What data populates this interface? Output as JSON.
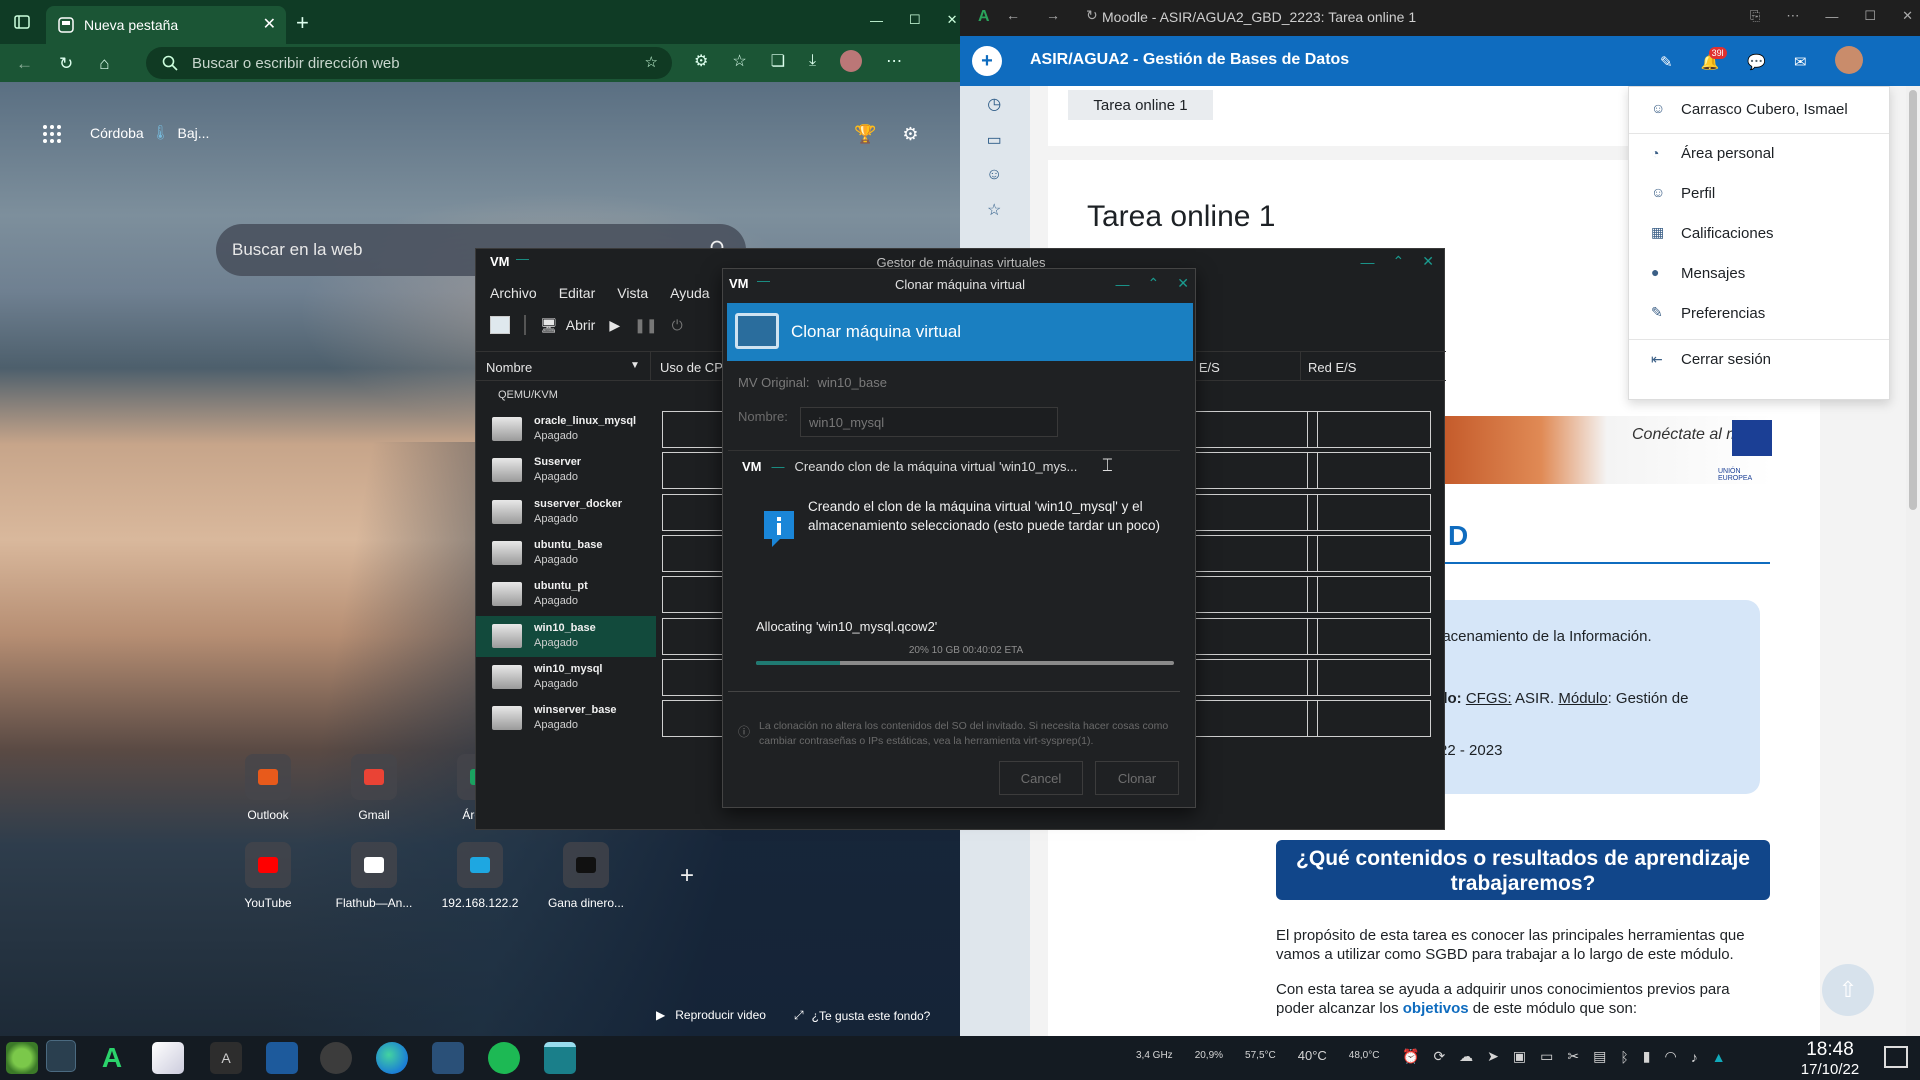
{
  "edge": {
    "tab_title": "Nueva pestaña",
    "address_placeholder": "Buscar o escribir dirección web",
    "weather_city": "Córdoba",
    "weather_text": "Baj...",
    "search_placeholder": "Buscar en la web",
    "tiles_row1": [
      {
        "label": "Outlook",
        "color": "#e85a1b"
      },
      {
        "label": "Gmail",
        "color": "#ea4335"
      },
      {
        "label": "Área p",
        "color": "#1aa260"
      }
    ],
    "tiles_row2": [
      {
        "label": "YouTube",
        "color": "#ff0000"
      },
      {
        "label": "Flathub—An...",
        "color": "#ffffff"
      },
      {
        "label": "192.168.122.2",
        "color": "#1ea7e1"
      },
      {
        "label": "Gana dinero...",
        "color": "#111111"
      }
    ],
    "play_video": "Reproducir video",
    "like_bg": "¿Te gusta este fondo?"
  },
  "moodle": {
    "window_title": "Moodle - ASIR/AGUA2_GBD_2223: Tarea online 1",
    "course_title": "ASIR/AGUA2 - Gestión de Bases de Datos",
    "notifications_count": "39l",
    "breadcrumb": "Tarea online 1",
    "heading": "Tarea online 1",
    "user_menu": [
      {
        "label": "Carrasco Cubero, Ismael",
        "icon": "user-icon"
      },
      {
        "label": "Área personal",
        "icon": "dashboard-icon"
      },
      {
        "label": "Perfil",
        "icon": "profile-icon"
      },
      {
        "label": "Calificaciones",
        "icon": "grades-icon"
      },
      {
        "label": "Mensajes",
        "icon": "message-icon"
      },
      {
        "label": "Preferencias",
        "icon": "wrench-icon"
      },
      {
        "label": "Cerrar sesión",
        "icon": "logout-icon"
      }
    ],
    "banner_text": "Conéctate al m",
    "banner_eu": "UNIÓN EUROPEA",
    "section_letter": "D",
    "info_line1": ": Almacenamiento de la Información.",
    "info_line2_bold": "y módulo:",
    "info_line2_u1": "CFGS:",
    "info_line2_mid": " ASIR. ",
    "info_line2_u2": "Módulo",
    "info_line2_end": ": Gestión de",
    "info_line3_bold": "o:",
    "info_line3_end": " 2022 - 2023",
    "blue_heading": "¿Qué contenidos o resultados de aprendizaje trabajaremos?",
    "para1": "El propósito de esta tarea es conocer las principales herramientas que vamos a utilizar como SGBD para trabajar a lo largo de este módulo.",
    "para2_start": "Con esta tarea se ayuda a adquirir unos conocimientos previos para poder alcanzar los ",
    "para2_link": "objetivos",
    "para2_end": " de este módulo que son:"
  },
  "virt": {
    "window_title": "Gestor de máquinas virtuales",
    "menu": [
      "Archivo",
      "Editar",
      "Vista",
      "Ayuda"
    ],
    "open_label": "Abrir",
    "col_name": "Nombre",
    "col_cpu": "Uso de CP",
    "col_disk": "o E/S",
    "col_net": "Red E/S",
    "connection": "QEMU/KVM",
    "vms": [
      {
        "name": "oracle_linux_mysql",
        "state": "Apagado"
      },
      {
        "name": "Suserver",
        "state": "Apagado"
      },
      {
        "name": "suserver_docker",
        "state": "Apagado"
      },
      {
        "name": "ubuntu_base",
        "state": "Apagado"
      },
      {
        "name": "ubuntu_pt",
        "state": "Apagado"
      },
      {
        "name": "win10_base",
        "state": "Apagado",
        "selected": true
      },
      {
        "name": "win10_mysql",
        "state": "Apagado"
      },
      {
        "name": "winserver_base",
        "state": "Apagado"
      }
    ]
  },
  "clone": {
    "window_title": "Clonar máquina virtual",
    "banner": "Clonar máquina virtual",
    "orig_label": "MV Original:",
    "orig_value": "win10_base",
    "name_label": "Nombre:",
    "name_value": "win10_mysql",
    "note": "La clonación no altera los contenidos del SO del invitado. Si necesita hacer cosas como cambiar contraseñas o IPs estáticas, vea la herramienta virt-sysprep(1).",
    "cancel": "Cancel",
    "clone": "Clonar"
  },
  "progress": {
    "title": "Creando clon de la máquina virtual 'win10_mys...",
    "message": "Creando el clon de la máquina virtual 'win10_mysql' y el almacenamiento seleccionado (esto puede tardar un poco)",
    "allocating": "Allocating 'win10_mysql.qcow2'",
    "stats": "20%  10 GB 00:40:02 ETA",
    "fraction": 0.2
  },
  "taskbar": {
    "cpu_freq": "3,4 GHz",
    "cpu_use": "20,9%",
    "temp1": "57,5°C",
    "temp2": "40°C",
    "temp3": "48,0°C",
    "time": "18:48",
    "date": "17/10/22"
  }
}
